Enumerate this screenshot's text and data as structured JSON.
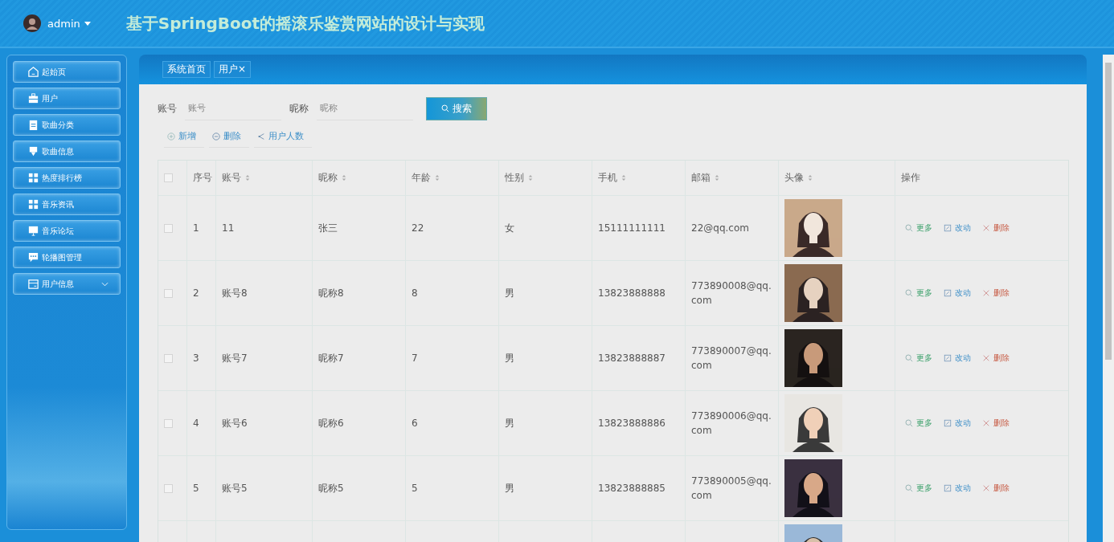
{
  "header": {
    "user": "admin",
    "title": "基于SpringBoot的摇滚乐鉴赏网站的设计与实现"
  },
  "sidebar": {
    "items": [
      {
        "kind": "link",
        "label": "起始页"
      },
      {
        "kind": "link",
        "label": "用户"
      },
      {
        "kind": "link",
        "label": "歌曲分类"
      },
      {
        "kind": "link",
        "label": "歌曲信息"
      },
      {
        "kind": "link",
        "label": "热度排行榜"
      },
      {
        "kind": "link",
        "label": "音乐资讯"
      },
      {
        "kind": "link",
        "label": "音乐论坛"
      },
      {
        "kind": "link",
        "label": "轮播图管理"
      },
      {
        "kind": "group",
        "label": "用户信息",
        "expanded": false
      }
    ]
  },
  "breadcrumbs": [
    {
      "label": "系统首页"
    },
    {
      "label": "用户",
      "close": "×"
    }
  ],
  "search": {
    "fields": [
      {
        "label": "账号",
        "placeholder": "账号"
      },
      {
        "label": "昵称",
        "placeholder": "昵称"
      }
    ],
    "button": "搜索"
  },
  "toolbar": [
    {
      "kind": "add",
      "label": "新增"
    },
    {
      "kind": "delete",
      "label": "删除"
    },
    {
      "kind": "stats",
      "label": "用户人数"
    }
  ],
  "table": {
    "all_checked": false,
    "columns": [
      {
        "label": "序号",
        "sortable": false
      },
      {
        "label": "账号",
        "sortable": true
      },
      {
        "label": "昵称",
        "sortable": true
      },
      {
        "label": "年龄",
        "sortable": true
      },
      {
        "label": "性别",
        "sortable": true
      },
      {
        "label": "手机",
        "sortable": true
      },
      {
        "label": "邮箱",
        "sortable": true
      },
      {
        "label": "头像",
        "sortable": true
      },
      {
        "label": "操作",
        "sortable": false
      }
    ],
    "rows": [
      {
        "checked": false,
        "cells": [
          "1",
          "11",
          "张三",
          "22",
          "女",
          "15111111111",
          "22@qq.com"
        ],
        "actions": [
          {
            "kind": "view",
            "label": "更多"
          },
          {
            "kind": "edit",
            "label": "改动"
          },
          {
            "kind": "delete",
            "label": "删除"
          }
        ]
      },
      {
        "checked": false,
        "cells": [
          "2",
          "账号8",
          "昵称8",
          "8",
          "男",
          "13823888888",
          "773890008@qq.com"
        ],
        "actions": [
          {
            "kind": "view",
            "label": "更多"
          },
          {
            "kind": "edit",
            "label": "改动"
          },
          {
            "kind": "delete",
            "label": "删除"
          }
        ]
      },
      {
        "checked": false,
        "cells": [
          "3",
          "账号7",
          "昵称7",
          "7",
          "男",
          "13823888887",
          "773890007@qq.com"
        ],
        "actions": [
          {
            "kind": "view",
            "label": "更多"
          },
          {
            "kind": "edit",
            "label": "改动"
          },
          {
            "kind": "delete",
            "label": "删除"
          }
        ]
      },
      {
        "checked": false,
        "cells": [
          "4",
          "账号6",
          "昵称6",
          "6",
          "男",
          "13823888886",
          "773890006@qq.com"
        ],
        "actions": [
          {
            "kind": "view",
            "label": "更多"
          },
          {
            "kind": "edit",
            "label": "改动"
          },
          {
            "kind": "delete",
            "label": "删除"
          }
        ]
      },
      {
        "checked": false,
        "cells": [
          "5",
          "账号5",
          "昵称5",
          "5",
          "男",
          "13823888885",
          "773890005@qq.com"
        ],
        "actions": [
          {
            "kind": "view",
            "label": "更多"
          },
          {
            "kind": "edit",
            "label": "改动"
          },
          {
            "kind": "delete",
            "label": "删除"
          }
        ]
      },
      {
        "cells": [],
        "actions": []
      }
    ]
  }
}
